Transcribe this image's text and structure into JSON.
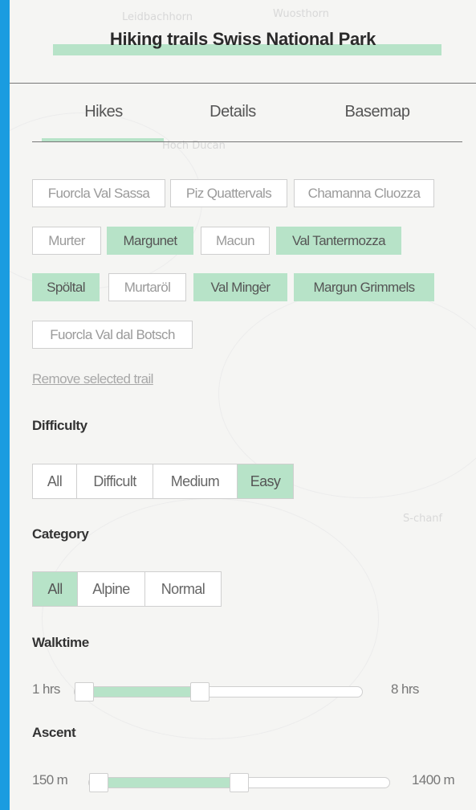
{
  "map": {
    "labels": [
      "Leidbachhorn",
      "Wuosthorn",
      "Hoch Ducan",
      "S-chanf"
    ]
  },
  "header": {
    "title": "Hiking trails Swiss National Park"
  },
  "tabs": [
    {
      "label": "Hikes",
      "active": true
    },
    {
      "label": "Details",
      "active": false
    },
    {
      "label": "Basemap",
      "active": false
    }
  ],
  "trails": [
    {
      "label": "Fuorcla Val Sassa",
      "selected": false
    },
    {
      "label": "Piz Quattervals",
      "selected": false
    },
    {
      "label": "Chamanna Cluozza",
      "selected": false
    },
    {
      "label": "Murter",
      "selected": false
    },
    {
      "label": "Margunet",
      "selected": true
    },
    {
      "label": "Macun",
      "selected": false
    },
    {
      "label": "Val Tantermozza",
      "selected": true
    },
    {
      "label": "Spöltal",
      "selected": true
    },
    {
      "label": "Murtaröl",
      "selected": false
    },
    {
      "label": "Val Mingèr",
      "selected": true
    },
    {
      "label": "Margun Grimmels",
      "selected": true
    },
    {
      "label": "Fuorcla Val dal Botsch",
      "selected": false
    }
  ],
  "remove_link": "Remove selected trail",
  "difficulty": {
    "label": "Difficulty",
    "options": [
      "All",
      "Difficult",
      "Medium",
      "Easy"
    ],
    "selected": "Easy"
  },
  "category": {
    "label": "Category",
    "options": [
      "All",
      "Alpine",
      "Normal"
    ],
    "selected": "All"
  },
  "walktime": {
    "label": "Walktime",
    "min_label": "1 hrs",
    "max_label": "8 hrs",
    "range_fraction": [
      0.0,
      0.43
    ]
  },
  "ascent": {
    "label": "Ascent",
    "min_label": "150 m",
    "max_label": "1400 m",
    "range_fraction": [
      0.0,
      0.5
    ]
  },
  "colors": {
    "accent": "#b7e3c8",
    "frame": "#1a9ce0"
  }
}
